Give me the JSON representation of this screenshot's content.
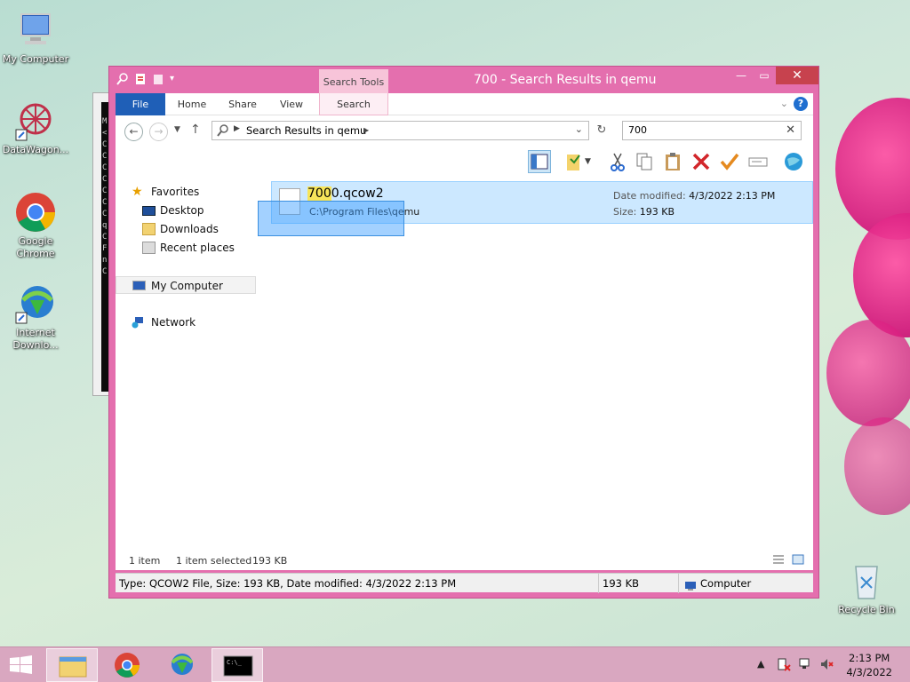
{
  "desktop": {
    "icons": [
      {
        "label": "My Computer"
      },
      {
        "label": "DataWagon..."
      },
      {
        "label": "Google Chrome"
      },
      {
        "label": "Internet Downlo..."
      },
      {
        "label": "Recycle Bin"
      }
    ]
  },
  "console": {
    "lines": "M\n<\nC\nC\nC\nC\nC\nC\nC\nq\nC\nF\nn\nC"
  },
  "window": {
    "title": "700 - Search Results in qemu",
    "ribbon": {
      "context_group": "Search Tools",
      "tabs": [
        "File",
        "Home",
        "Share",
        "View",
        "Search"
      ]
    },
    "address": {
      "path": "Search Results in qemu"
    },
    "search": {
      "value": "700",
      "placeholder": ""
    },
    "navpane": {
      "favorites": "Favorites",
      "desktop": "Desktop",
      "downloads": "Downloads",
      "recent": "Recent places",
      "computer": "My Computer",
      "network": "Network"
    },
    "results": [
      {
        "name_highlight": "700",
        "name_rest": "0.qcow2",
        "path": "C:\\Program Files\\qemu",
        "date_label": "Date modified:",
        "date": "4/3/2022 2:13 PM",
        "size_label": "Size:",
        "size": "193 KB"
      }
    ],
    "info": {
      "count": "1 item",
      "selected": "1 item selected",
      "selected_size": "193 KB"
    },
    "status": {
      "details": "Type: QCOW2 File, Size: 193 KB, Date modified: 4/3/2022 2:13 PM",
      "size": "193 KB",
      "location": "Computer"
    }
  },
  "taskbar": {
    "time": "2:13 PM",
    "date": "4/3/2022"
  },
  "colors": {
    "window_frame": "#e46fae",
    "selection": "#cce8ff",
    "highlight": "#f7e55a",
    "taskbar": "#d9a7c0"
  }
}
